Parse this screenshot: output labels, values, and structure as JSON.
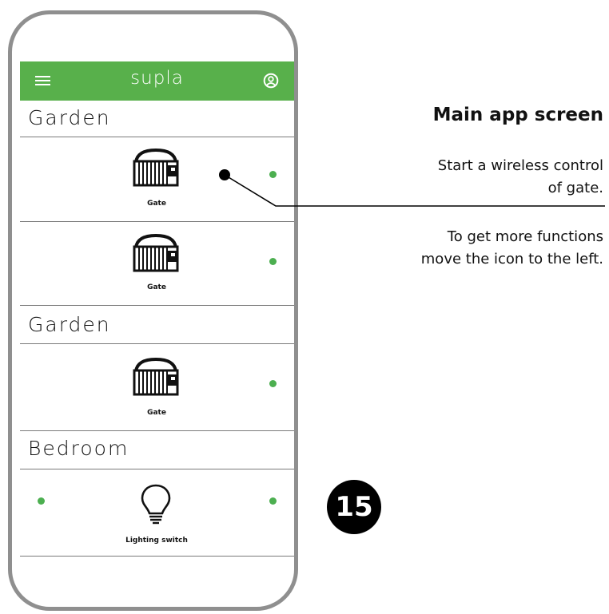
{
  "app": {
    "title": "supla",
    "menu_icon": "hamburger-menu-icon",
    "account_icon": "user-account-icon"
  },
  "sections": [
    {
      "label": "Garden",
      "devices": [
        {
          "label": "Gate",
          "icon": "gate-icon"
        },
        {
          "label": "Gate",
          "icon": "gate-icon"
        }
      ]
    },
    {
      "label": "Garden",
      "devices": [
        {
          "label": "Gate",
          "icon": "gate-icon"
        }
      ]
    },
    {
      "label": "Bedroom",
      "devices": [
        {
          "label": "Lighting switch",
          "icon": "light-bulb-icon"
        }
      ]
    }
  ],
  "annotation": {
    "headline": "Main app screen",
    "line1a": "Start a wireless control",
    "line1b": "of gate.",
    "line2a": "To get more functions",
    "line2b": "move the icon to the left.",
    "step_number": "15"
  },
  "colors": {
    "accent": "#58b04b",
    "status_dot": "#4caf50",
    "phone_frame": "#8f8f8f"
  }
}
